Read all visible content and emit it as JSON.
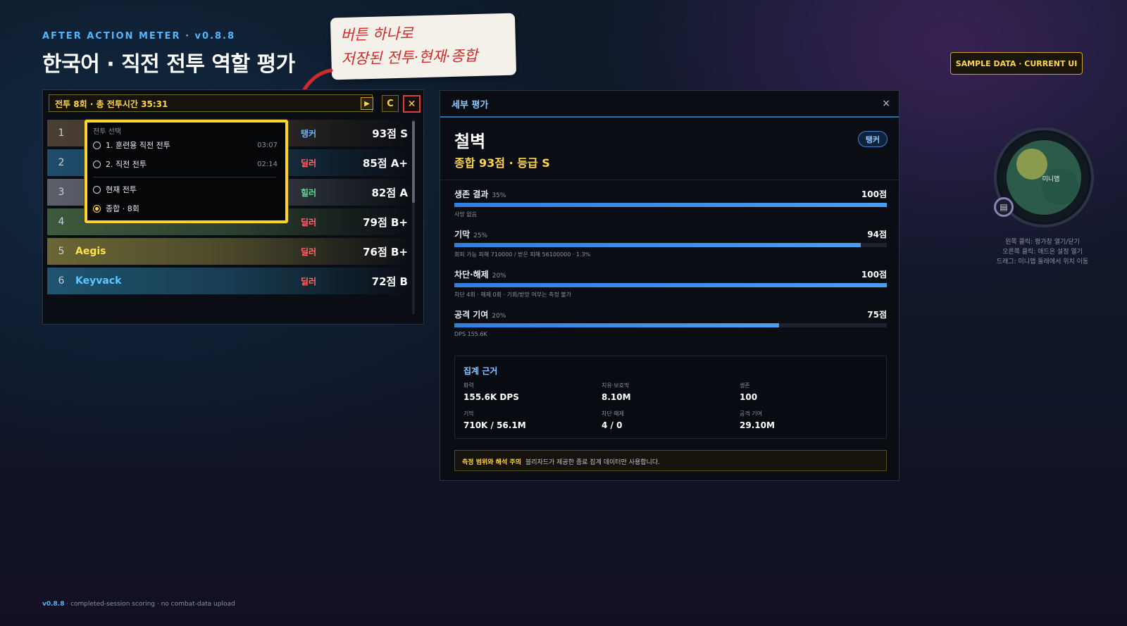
{
  "header": {
    "kicker": "AFTER ACTION METER · v0.8.8",
    "title": "한국어 · 직전 전투 역할 평가",
    "sample_badge": "SAMPLE DATA · CURRENT UI"
  },
  "callout": {
    "line1": "버튼 하나로",
    "line2": "저장된 전투·현재·종합"
  },
  "meter": {
    "title": "전투 8회 · 총 전투시간 35:31",
    "play_icon": "play-icon",
    "play_glyph": "▶",
    "c_label": "C",
    "close_glyph": "✕",
    "rows": [
      {
        "rank": "1",
        "name": "",
        "role": "탱커",
        "score": "93점 S",
        "bg": "#4a3f33",
        "role_color": "#6fb2ff",
        "name_color": "#ffffff"
      },
      {
        "rank": "2",
        "name": "",
        "role": "딜러",
        "score": "85점 A+",
        "bg": "#1f4d6b",
        "role_color": "#ff6b6b",
        "name_color": "#ffffff"
      },
      {
        "rank": "3",
        "name": "",
        "role": "힐러",
        "score": "82점 A",
        "bg": "#5a5f6a",
        "role_color": "#5fdc8a",
        "name_color": "#ffffff"
      },
      {
        "rank": "4",
        "name": "",
        "role": "딜러",
        "score": "79점 B+",
        "bg": "#3e5a3c",
        "role_color": "#ff6b6b",
        "name_color": "#ffffff"
      },
      {
        "rank": "5",
        "name": "Aegis",
        "role": "딜러",
        "score": "76점 B+",
        "bg": "#6b6635",
        "role_color": "#ff6b6b",
        "name_color": "#ffe14a"
      },
      {
        "rank": "6",
        "name": "Keyvack",
        "role": "딜러",
        "score": "72점 B",
        "bg": "#1f5470",
        "role_color": "#ff6b6b",
        "name_color": "#5cc8ff"
      }
    ]
  },
  "dropdown": {
    "heading": "전투 선택",
    "items": [
      {
        "label": "1. 훈련용 직전 전투",
        "time": "03:07",
        "selected": false
      },
      {
        "label": "2. 직전 전투",
        "time": "02:14",
        "selected": false
      },
      {
        "label": "현재 전투",
        "time": "",
        "selected": false
      },
      {
        "label": "종합 · 8회",
        "time": "",
        "selected": true
      }
    ]
  },
  "detail": {
    "title": "세부 평가",
    "close_glyph": "×",
    "player_name": "철벽",
    "summary": "종합 93점 · 등급 S",
    "role_pill": "탱커",
    "metrics": [
      {
        "name": "생존 결과",
        "weight": "35%",
        "score": "100점",
        "fill": 1.0,
        "note": "사망 없음"
      },
      {
        "name": "기막",
        "weight": "25%",
        "score": "94점",
        "fill": 0.94,
        "note": "회피 가능 피해 710000 / 받은 피해 56100000 · 1.3%"
      },
      {
        "name": "차단·해제",
        "weight": "20%",
        "score": "100점",
        "fill": 1.0,
        "note": "차단 4회 · 해제 0회 · 기회/받망 여부는 측정 불가"
      },
      {
        "name": "공격 기여",
        "weight": "20%",
        "score": "75점",
        "fill": 0.75,
        "note": "DPS 155.6K"
      }
    ],
    "basis": {
      "title": "집계 근거",
      "cells": [
        {
          "label": "화력",
          "value": "155.6K DPS"
        },
        {
          "label": "치유·보호막",
          "value": "8.10M"
        },
        {
          "label": "생존",
          "value": "100"
        },
        {
          "label": "기막",
          "value": "710K / 56.1M"
        },
        {
          "label": "차단·해제",
          "value": "4 / 0"
        },
        {
          "label": "공격 기여",
          "value": "29.10M"
        }
      ]
    },
    "caution": {
      "label": "측정 범위와 해석 주의",
      "text": "블리자드가 제공한 종료 집계 데이터만 사용합니다."
    }
  },
  "minimap": {
    "label": "미니맵",
    "button_icon": "list-icon",
    "button_glyph": "▤",
    "help": [
      "왼쪽 클릭: 평가창 열기/닫기",
      "오른쪽 클릭: 애드온 설정 열기",
      "드래그: 미니맵 둘레에서 위치 이동"
    ]
  },
  "footer": {
    "version": "v0.8.8",
    "text": " · completed-session scoring · no combat-data upload"
  }
}
